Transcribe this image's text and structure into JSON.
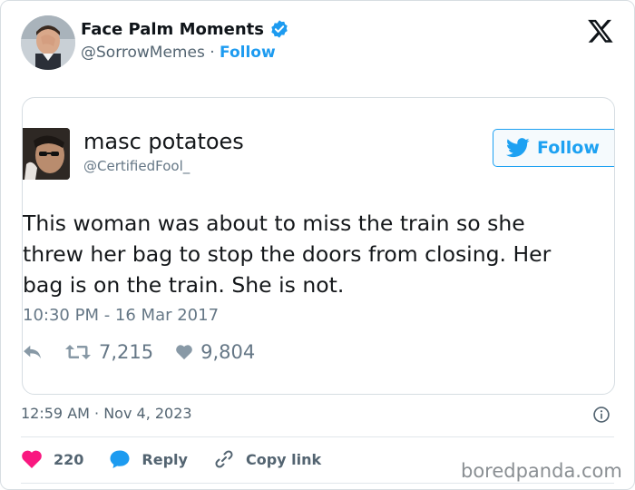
{
  "post": {
    "display_name": "Face Palm Moments",
    "handle": "@SorrowMemes",
    "separator": "·",
    "follow_label": "Follow",
    "timestamp": "12:59 AM · Nov 4, 2023"
  },
  "quoted": {
    "name": "masc potatoes",
    "handle": "@CertifiedFool_",
    "follow_label": "Follow",
    "text": "This woman was about to miss the train so she\nthrew her bag to stop the doors from closing. Her\nbag is on the train. She is not.",
    "time": "10:30 PM - 16 Mar 2017",
    "retweets": "7,215",
    "likes": "9,804"
  },
  "actions": {
    "like_count": "220",
    "reply_label": "Reply",
    "copy_label": "Copy link"
  },
  "watermark": "boredpanda.com",
  "colors": {
    "twitter_blue": "#1d9bf0",
    "old_twitter_blue": "#1da1f2",
    "like_red": "#f91880",
    "muted": "#536471"
  },
  "icons": [
    "verified-badge-icon",
    "x-logo-icon",
    "bird-icon",
    "reply-arrow-icon",
    "retweet-icon",
    "heart-icon",
    "info-icon",
    "speech-bubble-icon",
    "link-icon"
  ]
}
